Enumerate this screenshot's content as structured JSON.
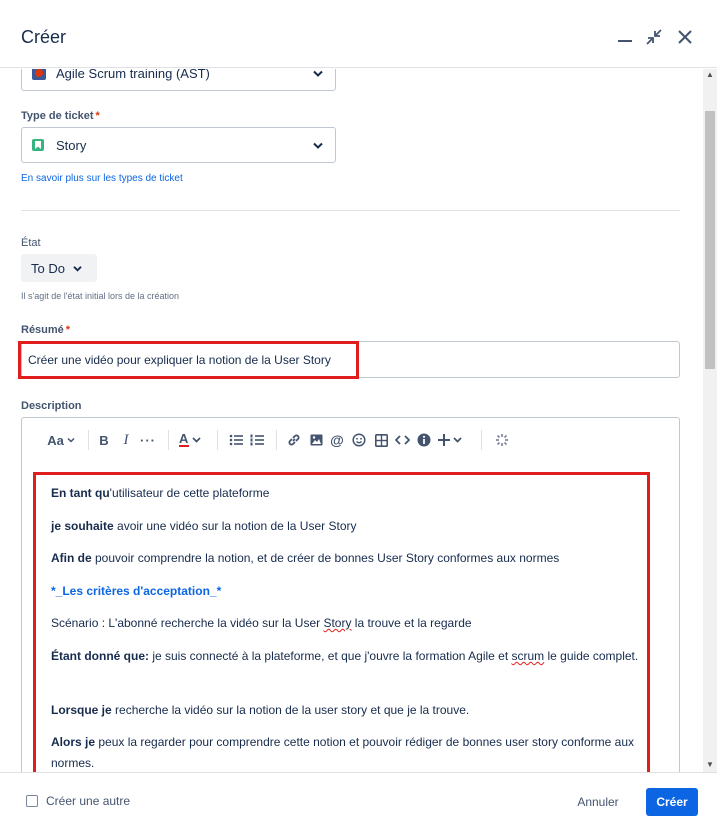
{
  "header": {
    "title": "Créer"
  },
  "project": {
    "value": "Agile Scrum training (AST)",
    "icon": "project-avatar-icon"
  },
  "ticket_type": {
    "label": "Type de ticket",
    "required_mark": "*",
    "value": "Story",
    "icon": "story-icon",
    "link": "En savoir plus sur les types de ticket"
  },
  "status": {
    "label": "État",
    "value": "To Do",
    "helper": "Il s'agit de l'état initial lors de la création"
  },
  "summary": {
    "label": "Résumé",
    "required_mark": "*",
    "value": "Créer une vidéo pour expliquer la notion de la User Story"
  },
  "description": {
    "label": "Description",
    "toolbar": {
      "text_style": "Aa"
    },
    "lines": [
      {
        "bold": "En tant qu",
        "text": "'utilisateur de cette plateforme"
      },
      {
        "bold": "je souhaite",
        "text": " avoir une vidéo sur la notion de la User Story"
      },
      {
        "bold": "Afin de",
        "text": " pouvoir comprendre la notion, et de créer de bonnes User Story conformes aux normes"
      },
      {
        "heading": "*_Les critères d'acceptation_*"
      },
      {
        "scenario_pre": "Scénario : L'abonné recherche la vidéo sur la User ",
        "scenario_err": "Story",
        "scenario_post": " la trouve et la regarde"
      },
      {
        "bold": " Étant donné que:",
        "text_pre": " je suis connecté à la plateforme, et que j'ouvre la formation Agile et ",
        "text_err": "scrum",
        "text_post": " le guide complet."
      },
      {
        "bold": "Lorsque je",
        "text": " recherche la vidéo sur la notion de la user story et que je la trouve."
      },
      {
        "bold": "Alors je",
        "text": " peux la regarder pour comprendre cette notion et pouvoir rédiger de bonnes user story conforme aux normes."
      }
    ]
  },
  "footer": {
    "create_another": "Créer une autre",
    "cancel": "Annuler",
    "create": "Créer"
  },
  "colors": {
    "accent": "#0c66e4",
    "highlight": "#e01e1e",
    "story_green": "#36b37e"
  }
}
